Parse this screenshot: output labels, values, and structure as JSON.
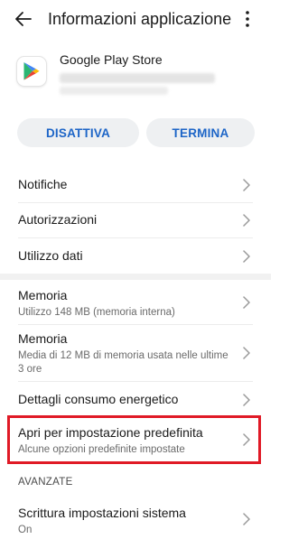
{
  "header": {
    "title": "Informazioni applicazione",
    "back_icon": "arrow-left-icon",
    "more_icon": "more-vertical-icon"
  },
  "app": {
    "name": "Google Play Store",
    "icon": "google-play-icon"
  },
  "actions": {
    "disable_label": "DISATTIVA",
    "stop_label": "TERMINA"
  },
  "colors": {
    "accent": "#1d65c7",
    "highlight_border": "#e01a26",
    "secondary_text": "#6a6a6a"
  },
  "items": {
    "notifiche": {
      "label": "Notifiche"
    },
    "autorizzazioni": {
      "label": "Autorizzazioni"
    },
    "utilizzo_dati": {
      "label": "Utilizzo dati"
    },
    "memoria": {
      "label": "Memoria",
      "sub": "Utilizzo 148 MB (memoria interna)"
    },
    "memoria_ram": {
      "label": "Memoria",
      "sub": "Media di 12 MB di memoria usata nelle ultime 3 ore"
    },
    "dettagli_energia": {
      "label": "Dettagli consumo energetico"
    },
    "apri_predefinita": {
      "label": "Apri per impostazione predefinita",
      "sub": "Alcune opzioni predefinite impostate"
    },
    "scrittura_sistema": {
      "label": "Scrittura impostazioni sistema"
    }
  },
  "sections": {
    "avanzate": "AVANZATE"
  }
}
